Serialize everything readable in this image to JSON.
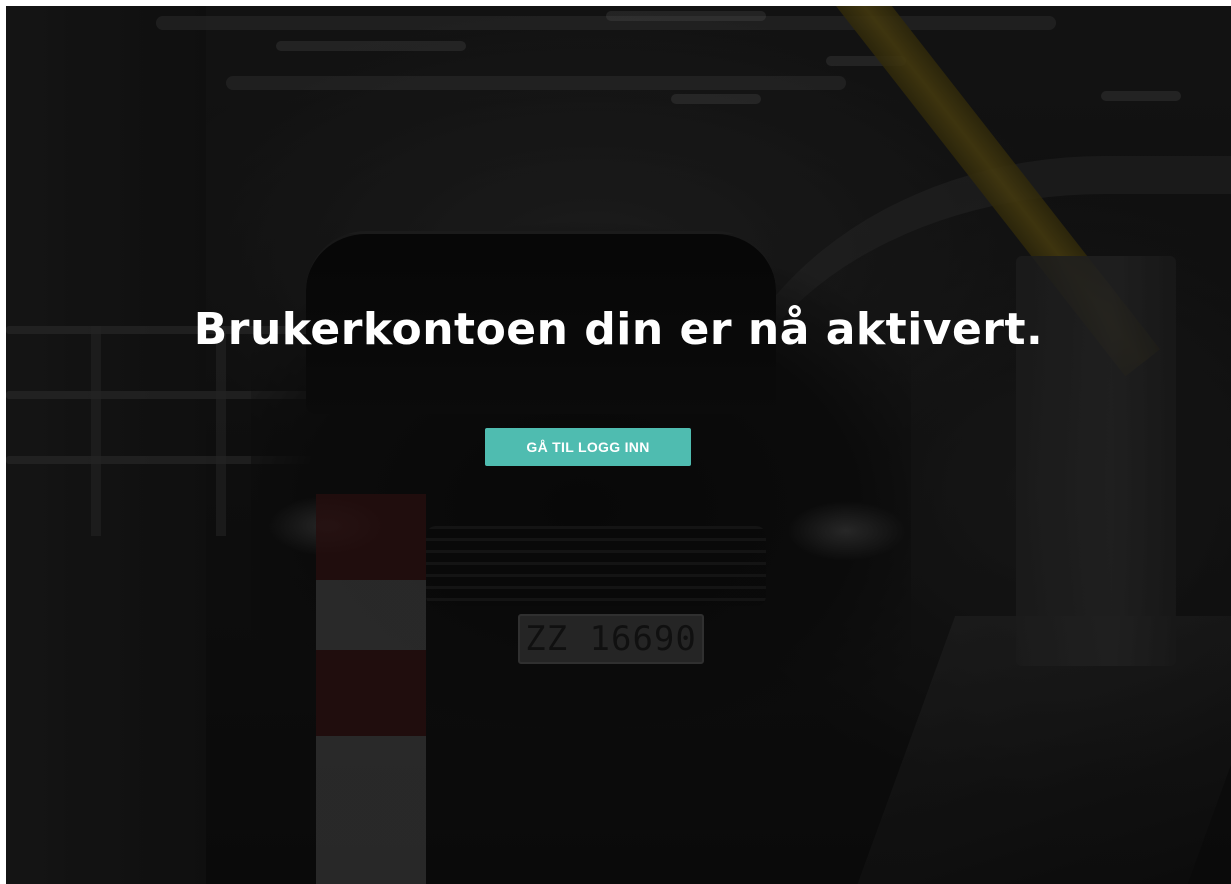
{
  "page": {
    "headline": "Brukerkontoen din er nå aktivert.",
    "cta_label": "GÅ TIL LOGG INN",
    "background_image": "dark-parking-garage-car-photo",
    "license_plate": "ZZ 16690"
  },
  "colors": {
    "accent": "#4fbcb0",
    "text": "#ffffff",
    "background": "#151515"
  }
}
